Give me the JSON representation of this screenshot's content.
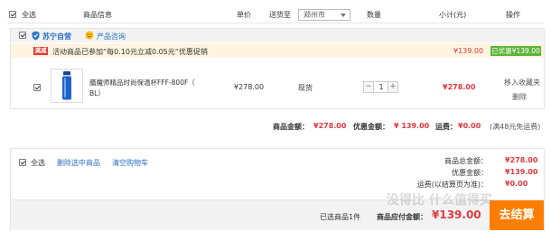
{
  "header": {
    "select_all": "全选",
    "product_info": "商品信息",
    "unit_price": "单价",
    "ship_to": "送货至",
    "city": "郑州市",
    "quantity": "数量",
    "subtotal": "小计(元)",
    "action": "操作"
  },
  "store": {
    "name": "苏宁自营",
    "consult": "产品咨询"
  },
  "promo": {
    "badge": "满减",
    "text": "活动商品已参加“每0.10元立减0.05元”优惠促销",
    "price": "¥139.00",
    "saved": "已优惠¥139.00"
  },
  "item": {
    "name_line1": "膳魔师精品时尚保温杯FFF-800F（",
    "name_line2": "BL）",
    "unit_price": "¥278.00",
    "stock": "现货",
    "minus": "−",
    "qty": "1",
    "plus": "+",
    "subtotal": "¥278.00",
    "move_to_fav": "移入收藏夹",
    "delete": "删除"
  },
  "totals": {
    "goods_label": "商品金额：",
    "goods_value": "¥278.00",
    "discount_label": "优惠金额：",
    "discount_value": "¥ 139.00",
    "freight_label": "运费：",
    "freight_value": "¥0.00",
    "freight_note": "(满48元免运费)"
  },
  "footer": {
    "select_all": "全选",
    "delete_selected": "删除选中商品",
    "clear_cart": "清空购物车",
    "sum_label": "商品总金额：",
    "sum_value": "¥278.00",
    "disc_label": "优惠金额：",
    "disc_value": "¥139.00",
    "freight_label": "运费(以结算页为准)：",
    "freight_value": "¥0.00",
    "selected_count": "已选商品1件",
    "payable_label": "商品应付金额：",
    "payable_value": "¥139.00",
    "checkout": "去结算"
  },
  "watermark": "没得比 什么值得买",
  "colors": {
    "accent_red": "#e4393c",
    "checkout_orange": "#ff7e00",
    "saved_green": "#5db539",
    "promo_bg": "#fff4e0"
  }
}
